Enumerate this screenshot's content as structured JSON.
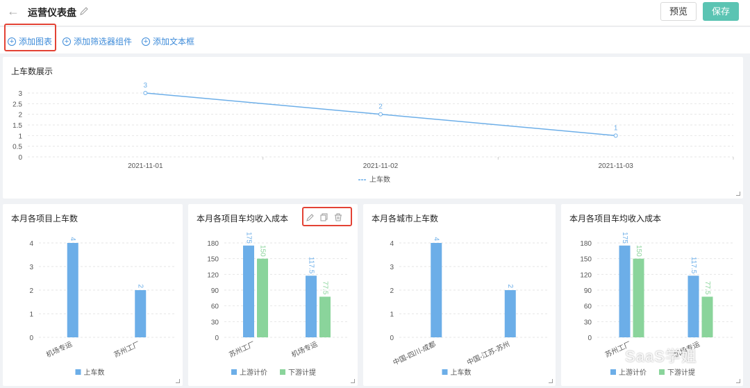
{
  "header": {
    "title": "运营仪表盘",
    "preview_label": "预览",
    "save_label": "保存"
  },
  "toolbar": {
    "add_chart": "添加图表",
    "add_filter": "添加筛选器组件",
    "add_textbox": "添加文本框"
  },
  "colors": {
    "blue": "#6caee8",
    "green": "#8ad49b",
    "accent": "#5bc4b3",
    "link": "#3d8bd9",
    "highlight": "#e34234"
  },
  "chart_data": [
    {
      "type": "line",
      "title": "上车数展示",
      "categories": [
        "2021-11-01",
        "2021-11-02",
        "2021-11-03"
      ],
      "series": [
        {
          "name": "上车数",
          "values": [
            3,
            2,
            1
          ]
        }
      ],
      "y_ticks": [
        "0",
        "0.5",
        "1",
        "1.5",
        "2",
        "2.5",
        "3"
      ],
      "ylim": [
        0,
        3
      ],
      "grid": true,
      "legend": "bottom"
    },
    {
      "type": "bar",
      "title": "本月各项目上车数",
      "categories": [
        "机场专运",
        "苏州工厂"
      ],
      "series": [
        {
          "name": "上车数",
          "values": [
            4,
            2
          ]
        }
      ],
      "y_ticks": [
        "0",
        "1",
        "2",
        "3",
        "4"
      ],
      "ylim": [
        0,
        4
      ],
      "legend": "bottom"
    },
    {
      "type": "bar",
      "title": "本月各项目车均收入成本",
      "categories": [
        "苏州工厂",
        "机场专运"
      ],
      "series": [
        {
          "name": "上游计价",
          "values": [
            175,
            117.5
          ]
        },
        {
          "name": "下游计提",
          "values": [
            150,
            77.5
          ]
        }
      ],
      "y_ticks": [
        "0",
        "30",
        "60",
        "90",
        "120",
        "150",
        "180"
      ],
      "ylim": [
        0,
        180
      ],
      "legend": "bottom"
    },
    {
      "type": "bar",
      "title": "本月各城市上车数",
      "categories": [
        "中国-四川-成都",
        "中国-江苏-苏州"
      ],
      "series": [
        {
          "name": "上车数",
          "values": [
            4,
            2
          ]
        }
      ],
      "y_ticks": [
        "0",
        "1",
        "2",
        "3",
        "4"
      ],
      "ylim": [
        0,
        4
      ],
      "legend": "bottom"
    },
    {
      "type": "bar",
      "title": "本月各项目车均收入成本",
      "categories": [
        "苏州工厂",
        "机场专运"
      ],
      "series": [
        {
          "name": "上游计价",
          "values": [
            175,
            117.5
          ]
        },
        {
          "name": "下游计提",
          "values": [
            150,
            77.5
          ]
        }
      ],
      "y_ticks": [
        "0",
        "30",
        "60",
        "90",
        "120",
        "150",
        "180"
      ],
      "ylim": [
        0,
        180
      ],
      "legend": "bottom"
    }
  ],
  "watermark": "SaaS学姐"
}
